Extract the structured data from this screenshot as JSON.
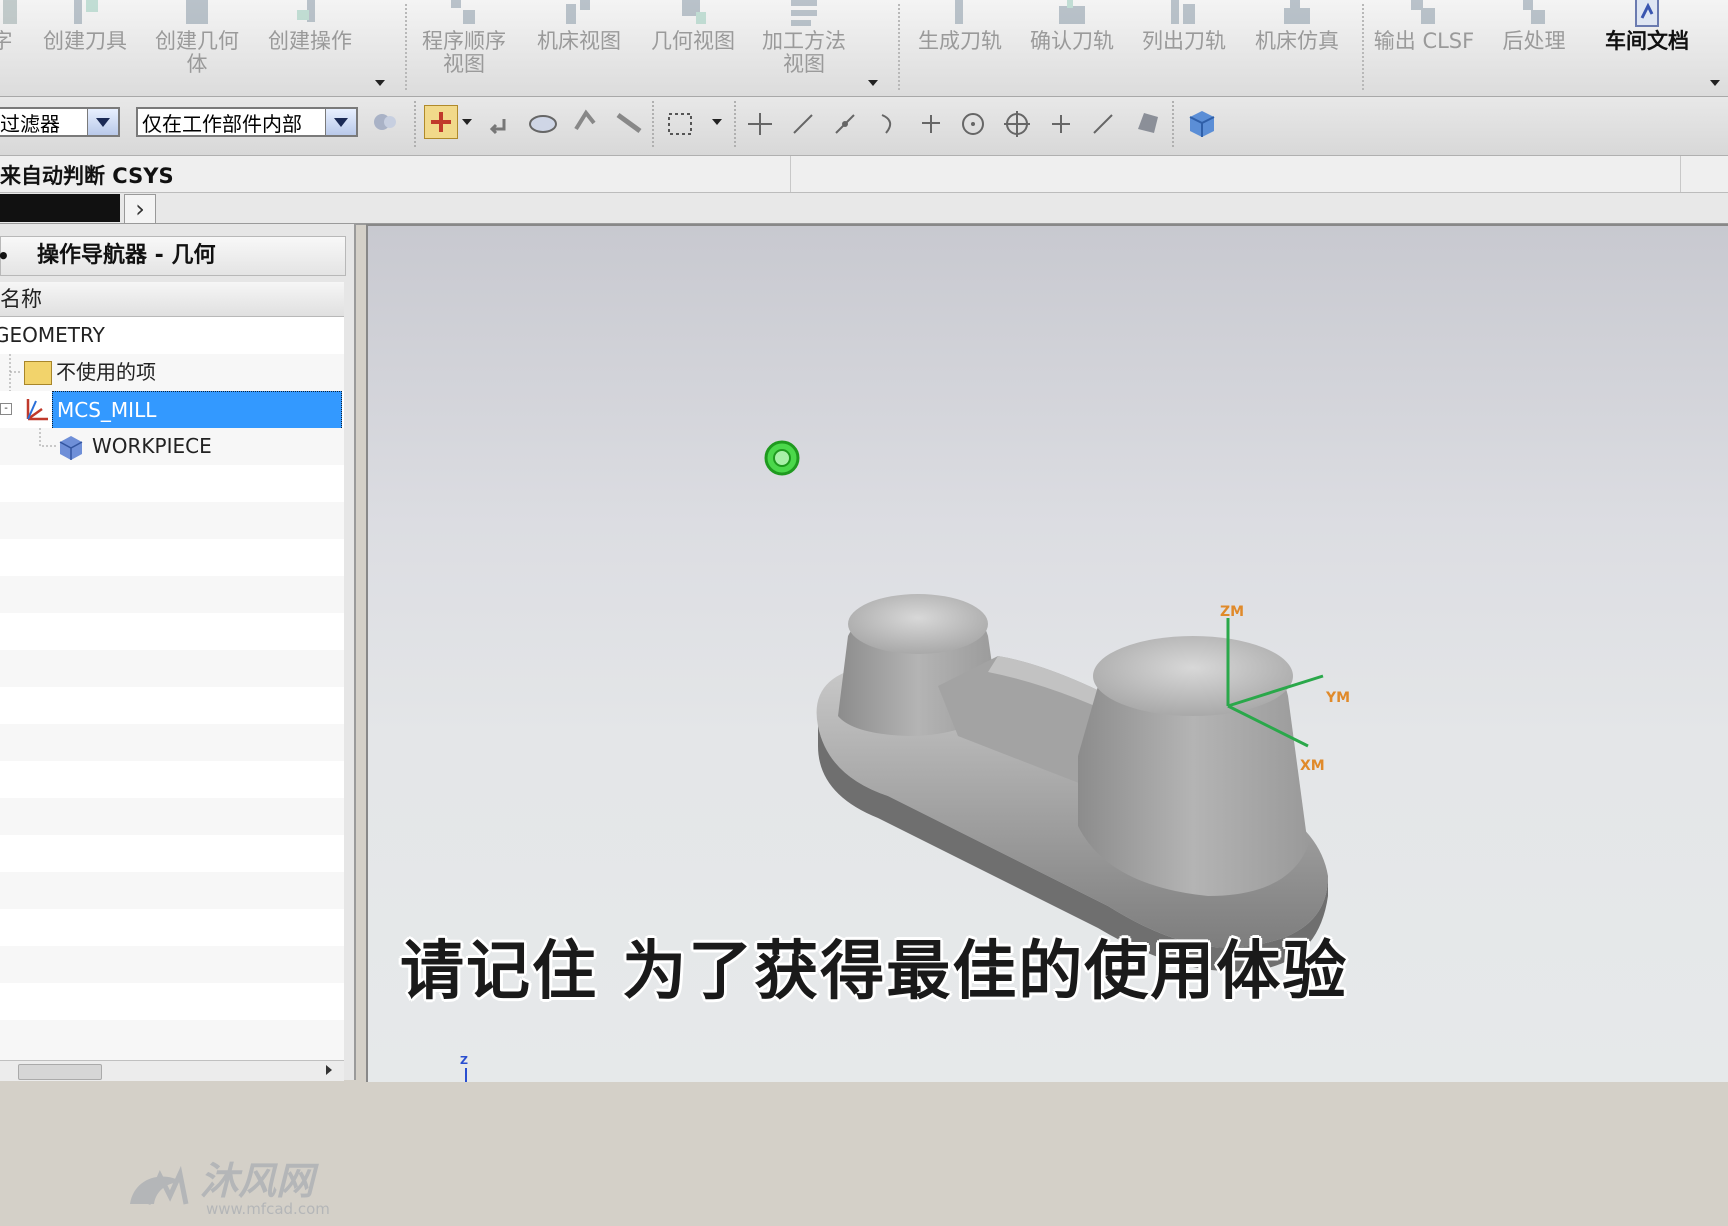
{
  "ribbon": {
    "groups": [
      {
        "label": "字",
        "active": false
      },
      {
        "label": "创建刀具",
        "active": false
      },
      {
        "label": "创建几何体",
        "active": false
      },
      {
        "label": "创建操作",
        "active": false
      },
      {
        "label": "程序顺序视图",
        "active": false
      },
      {
        "label": "机床视图",
        "active": false
      },
      {
        "label": "几何视图",
        "active": false
      },
      {
        "label": "加工方法视图",
        "active": false
      },
      {
        "label": "生成刀轨",
        "active": false
      },
      {
        "label": "确认刀轨",
        "active": false
      },
      {
        "label": "列出刀轨",
        "active": false
      },
      {
        "label": "机床仿真",
        "active": false
      },
      {
        "label": "输出 CLSF",
        "active": false
      },
      {
        "label": "后处理",
        "active": false
      },
      {
        "label": "车间文档",
        "active": true
      }
    ]
  },
  "filterbar": {
    "type_filter": "过滤器",
    "scope_filter": "仅在工作部件内部"
  },
  "prompt": {
    "text": "来自动判断 CSYS"
  },
  "navigator": {
    "title": "操作导航器 - 几何",
    "column_header": "名称",
    "root": "GEOMETRY",
    "items": [
      {
        "label": "不使用的项",
        "icon": "folder-icon"
      },
      {
        "label": "MCS_MILL",
        "icon": "mcs-icon",
        "selected": true
      },
      {
        "label": "WORKPIECE",
        "icon": "workpiece-cube-icon"
      }
    ]
  },
  "viewport": {
    "axes": {
      "z": "ZM",
      "y": "YM",
      "x": "XM"
    },
    "triad_label": "Z"
  },
  "subtitle": "请记住 为了获得最佳的使用体验",
  "watermark": {
    "name": "沐风网",
    "url": "www.mfcad.com"
  },
  "colors": {
    "selection": "#3399ff",
    "axis": "#2aa84a",
    "axis_label": "#e08a2a"
  }
}
